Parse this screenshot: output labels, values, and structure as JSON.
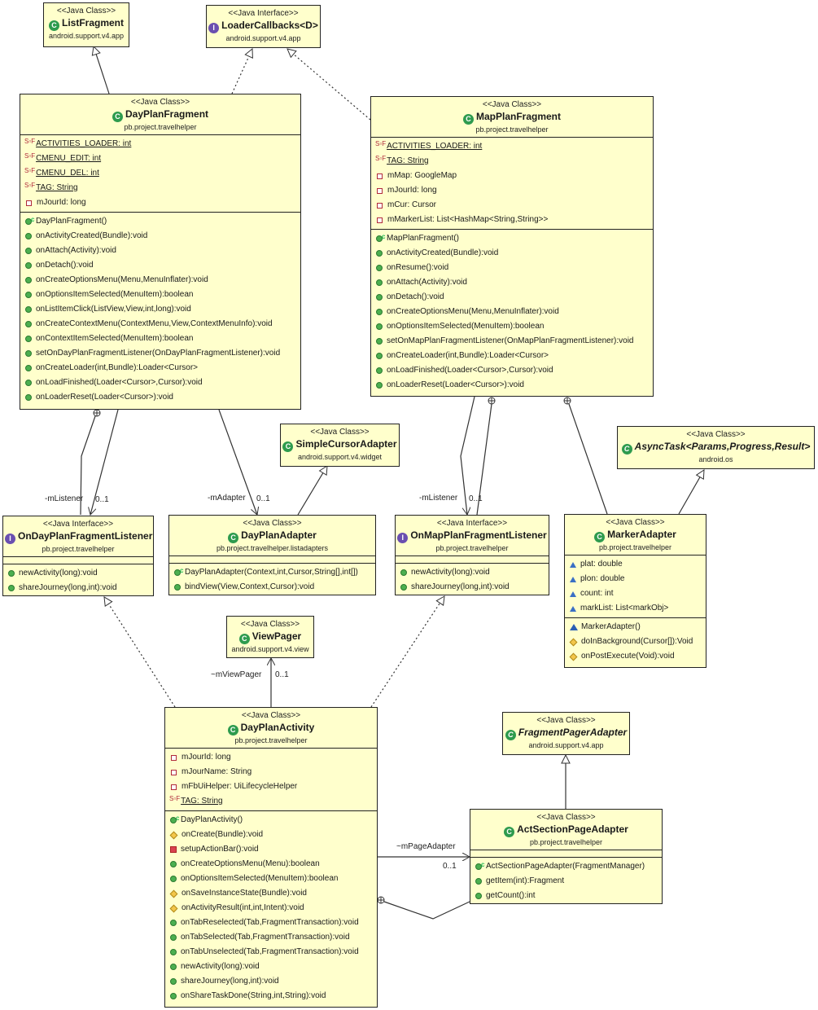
{
  "diagram": {
    "type": "UML class diagram",
    "classes": {
      "listFragment": {
        "stereotype": "<<Java Class>>",
        "name": "ListFragment",
        "package": "android.support.v4.app",
        "kind": "class"
      },
      "loaderCallbacks": {
        "stereotype": "<<Java Interface>>",
        "name": "LoaderCallbacks<D>",
        "package": "android.support.v4.app",
        "kind": "interface"
      },
      "dayPlanFragment": {
        "stereotype": "<<Java Class>>",
        "name": "DayPlanFragment",
        "package": "pb.project.travelhelper",
        "kind": "class",
        "fields": [
          {
            "text": "ACTIVITIES_LOADER: int",
            "visibility": "private-static-final"
          },
          {
            "text": "CMENU_EDIT: int",
            "visibility": "private-static-final"
          },
          {
            "text": "CMENU_DEL: int",
            "visibility": "private-static-final"
          },
          {
            "text": "TAG: String",
            "visibility": "private-static-final"
          },
          {
            "text": "mJourId: long",
            "visibility": "private"
          }
        ],
        "methods": [
          {
            "text": "DayPlanFragment()",
            "visibility": "constructor"
          },
          {
            "text": "onActivityCreated(Bundle):void",
            "visibility": "public"
          },
          {
            "text": "onAttach(Activity):void",
            "visibility": "public"
          },
          {
            "text": "onDetach():void",
            "visibility": "public"
          },
          {
            "text": "onCreateOptionsMenu(Menu,MenuInflater):void",
            "visibility": "public"
          },
          {
            "text": "onOptionsItemSelected(MenuItem):boolean",
            "visibility": "public"
          },
          {
            "text": "onListItemClick(ListView,View,int,long):void",
            "visibility": "public"
          },
          {
            "text": "onCreateContextMenu(ContextMenu,View,ContextMenuInfo):void",
            "visibility": "public"
          },
          {
            "text": "onContextItemSelected(MenuItem):boolean",
            "visibility": "public"
          },
          {
            "text": "setOnDayPlanFragmentListener(OnDayPlanFragmentListener):void",
            "visibility": "public"
          },
          {
            "text": "onCreateLoader(int,Bundle):Loader<Cursor>",
            "visibility": "public"
          },
          {
            "text": "onLoadFinished(Loader<Cursor>,Cursor):void",
            "visibility": "public"
          },
          {
            "text": "onLoaderReset(Loader<Cursor>):void",
            "visibility": "public"
          }
        ]
      },
      "mapPlanFragment": {
        "stereotype": "<<Java Class>>",
        "name": "MapPlanFragment",
        "package": "pb.project.travelhelper",
        "kind": "class",
        "fields": [
          {
            "text": "ACTIVITIES_LOADER: int",
            "visibility": "private-static-final"
          },
          {
            "text": "TAG: String",
            "visibility": "private-static-final"
          },
          {
            "text": "mMap: GoogleMap",
            "visibility": "private"
          },
          {
            "text": "mJourId: long",
            "visibility": "private"
          },
          {
            "text": "mCur: Cursor",
            "visibility": "private"
          },
          {
            "text": "mMarkerList: List<HashMap<String,String>>",
            "visibility": "private"
          }
        ],
        "methods": [
          {
            "text": "MapPlanFragment()",
            "visibility": "constructor"
          },
          {
            "text": "onActivityCreated(Bundle):void",
            "visibility": "public"
          },
          {
            "text": "onResume():void",
            "visibility": "public"
          },
          {
            "text": "onAttach(Activity):void",
            "visibility": "public"
          },
          {
            "text": "onDetach():void",
            "visibility": "public"
          },
          {
            "text": "onCreateOptionsMenu(Menu,MenuInflater):void",
            "visibility": "public"
          },
          {
            "text": "onOptionsItemSelected(MenuItem):boolean",
            "visibility": "public"
          },
          {
            "text": "setOnMapPlanFragmentListener(OnMapPlanFragmentListener):void",
            "visibility": "public"
          },
          {
            "text": "onCreateLoader(int,Bundle):Loader<Cursor>",
            "visibility": "public"
          },
          {
            "text": "onLoadFinished(Loader<Cursor>,Cursor):void",
            "visibility": "public"
          },
          {
            "text": "onLoaderReset(Loader<Cursor>):void",
            "visibility": "public"
          }
        ]
      },
      "simpleCursorAdapter": {
        "stereotype": "<<Java Class>>",
        "name": "SimpleCursorAdapter",
        "package": "android.support.v4.widget",
        "kind": "class"
      },
      "asyncTask": {
        "stereotype": "<<Java Class>>",
        "name": "AsyncTask<Params,Progress,Result>",
        "package": "android.os",
        "kind": "abstract-class"
      },
      "onDayPlanFragmentListener": {
        "stereotype": "<<Java Interface>>",
        "name": "OnDayPlanFragmentListener",
        "package": "pb.project.travelhelper",
        "kind": "interface",
        "methods": [
          {
            "text": "newActivity(long):void",
            "visibility": "public"
          },
          {
            "text": "shareJourney(long,int):void",
            "visibility": "public"
          }
        ]
      },
      "dayPlanAdapter": {
        "stereotype": "<<Java Class>>",
        "name": "DayPlanAdapter",
        "package": "pb.project.travelhelper.listadapters",
        "kind": "class",
        "methods": [
          {
            "text": "DayPlanAdapter(Context,int,Cursor,String[],int[])",
            "visibility": "constructor"
          },
          {
            "text": "bindView(View,Context,Cursor):void",
            "visibility": "public"
          }
        ]
      },
      "onMapPlanFragmentListener": {
        "stereotype": "<<Java Interface>>",
        "name": "OnMapPlanFragmentListener",
        "package": "pb.project.travelhelper",
        "kind": "interface",
        "methods": [
          {
            "text": "newActivity(long):void",
            "visibility": "public"
          },
          {
            "text": "shareJourney(long,int):void",
            "visibility": "public"
          }
        ]
      },
      "markerAdapter": {
        "stereotype": "<<Java Class>>",
        "name": "MarkerAdapter",
        "package": "pb.project.travelhelper",
        "kind": "class",
        "fields": [
          {
            "text": "plat: double",
            "visibility": "package"
          },
          {
            "text": "plon: double",
            "visibility": "package"
          },
          {
            "text": "count: int",
            "visibility": "package"
          },
          {
            "text": "markList: List<markObj>",
            "visibility": "package"
          }
        ],
        "methods": [
          {
            "text": "MarkerAdapter()",
            "visibility": "package-constructor"
          },
          {
            "text": "doInBackground(Cursor[]):Void",
            "visibility": "protected"
          },
          {
            "text": "onPostExecute(Void):void",
            "visibility": "protected"
          }
        ]
      },
      "viewPager": {
        "stereotype": "<<Java Class>>",
        "name": "ViewPager",
        "package": "android.support.v4.view",
        "kind": "class"
      },
      "dayPlanActivity": {
        "stereotype": "<<Java Class>>",
        "name": "DayPlanActivity",
        "package": "pb.project.travelhelper",
        "kind": "class",
        "fields": [
          {
            "text": "mJourId: long",
            "visibility": "private"
          },
          {
            "text": "mJourName: String",
            "visibility": "private"
          },
          {
            "text": "mFbUiHelper: UiLifecycleHelper",
            "visibility": "private"
          },
          {
            "text": "TAG: String",
            "visibility": "private-static-final"
          }
        ],
        "methods": [
          {
            "text": "DayPlanActivity()",
            "visibility": "constructor"
          },
          {
            "text": "onCreate(Bundle):void",
            "visibility": "protected"
          },
          {
            "text": "setupActionBar():void",
            "visibility": "private-method"
          },
          {
            "text": "onCreateOptionsMenu(Menu):boolean",
            "visibility": "public"
          },
          {
            "text": "onOptionsItemSelected(MenuItem):boolean",
            "visibility": "public"
          },
          {
            "text": "onSaveInstanceState(Bundle):void",
            "visibility": "protected"
          },
          {
            "text": "onActivityResult(int,int,Intent):void",
            "visibility": "protected"
          },
          {
            "text": "onTabReselected(Tab,FragmentTransaction):void",
            "visibility": "public"
          },
          {
            "text": "onTabSelected(Tab,FragmentTransaction):void",
            "visibility": "public"
          },
          {
            "text": "onTabUnselected(Tab,FragmentTransaction):void",
            "visibility": "public"
          },
          {
            "text": "newActivity(long):void",
            "visibility": "public"
          },
          {
            "text": "shareJourney(long,int):void",
            "visibility": "public"
          },
          {
            "text": "onShareTaskDone(String,int,String):void",
            "visibility": "public"
          }
        ]
      },
      "fragmentPagerAdapter": {
        "stereotype": "<<Java Class>>",
        "name": "FragmentPagerAdapter",
        "package": "android.support.v4.app",
        "kind": "abstract-class"
      },
      "actSectionPageAdapter": {
        "stereotype": "<<Java Class>>",
        "name": "ActSectionPageAdapter",
        "package": "pb.project.travelhelper",
        "kind": "class",
        "methods": [
          {
            "text": "ActSectionPageAdapter(FragmentManager)",
            "visibility": "constructor"
          },
          {
            "text": "getItem(int):Fragment",
            "visibility": "public"
          },
          {
            "text": "getCount():int",
            "visibility": "public"
          }
        ]
      }
    },
    "edge_labels": {
      "dpf_listener_role": "-mListener",
      "dpf_listener_mult": "0..1",
      "dpf_adapter_role": "-mAdapter",
      "dpf_adapter_mult": "0..1",
      "mpf_listener_role": "-mListener",
      "mpf_listener_mult": "0..1",
      "act_viewpager_role": "~mViewPager",
      "act_viewpager_mult": "0..1",
      "act_pageadapter_role": "~mPageAdapter",
      "act_pageadapter_mult": "0..1"
    },
    "relationships": [
      {
        "from": "DayPlanFragment",
        "to": "ListFragment",
        "type": "generalization"
      },
      {
        "from": "DayPlanFragment",
        "to": "LoaderCallbacks<D>",
        "type": "realization"
      },
      {
        "from": "MapPlanFragment",
        "to": "LoaderCallbacks<D>",
        "type": "realization"
      },
      {
        "from": "DayPlanFragment",
        "to": "OnDayPlanFragmentListener",
        "type": "association",
        "role": "-mListener",
        "multiplicity": "0..1"
      },
      {
        "from": "DayPlanFragment",
        "to": "OnDayPlanFragmentListener",
        "type": "nesting"
      },
      {
        "from": "DayPlanFragment",
        "to": "DayPlanAdapter",
        "type": "association",
        "role": "-mAdapter",
        "multiplicity": "0..1"
      },
      {
        "from": "DayPlanAdapter",
        "to": "SimpleCursorAdapter",
        "type": "generalization"
      },
      {
        "from": "MapPlanFragment",
        "to": "OnMapPlanFragmentListener",
        "type": "association",
        "role": "-mListener",
        "multiplicity": "0..1"
      },
      {
        "from": "MapPlanFragment",
        "to": "OnMapPlanFragmentListener",
        "type": "nesting"
      },
      {
        "from": "MapPlanFragment",
        "to": "MarkerAdapter",
        "type": "nesting"
      },
      {
        "from": "MarkerAdapter",
        "to": "AsyncTask<Params,Progress,Result>",
        "type": "generalization"
      },
      {
        "from": "DayPlanActivity",
        "to": "OnDayPlanFragmentListener",
        "type": "realization"
      },
      {
        "from": "DayPlanActivity",
        "to": "OnMapPlanFragmentListener",
        "type": "realization"
      },
      {
        "from": "DayPlanActivity",
        "to": "ViewPager",
        "type": "association",
        "role": "~mViewPager",
        "multiplicity": "0..1"
      },
      {
        "from": "DayPlanActivity",
        "to": "ActSectionPageAdapter",
        "type": "association",
        "role": "~mPageAdapter",
        "multiplicity": "0..1"
      },
      {
        "from": "DayPlanActivity",
        "to": "ActSectionPageAdapter",
        "type": "nesting"
      },
      {
        "from": "ActSectionPageAdapter",
        "to": "FragmentPagerAdapter",
        "type": "generalization"
      }
    ]
  }
}
